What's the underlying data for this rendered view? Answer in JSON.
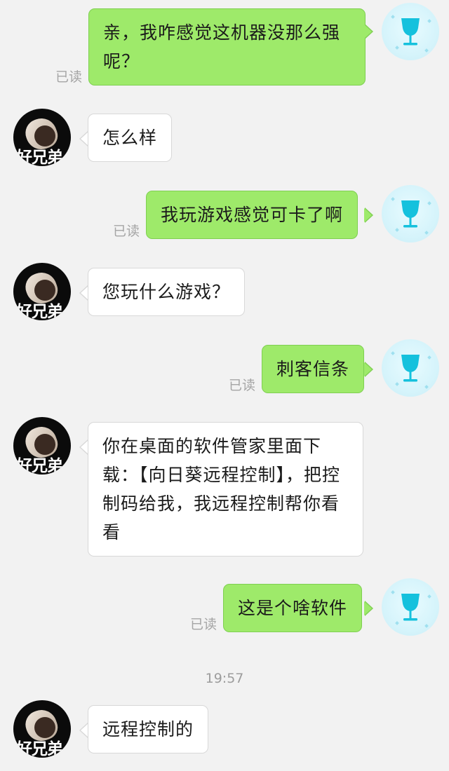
{
  "chat": {
    "read_label": "已读",
    "timestamp": "19:57",
    "other_avatar_text": "好兄弟",
    "messages": [
      {
        "from": "self",
        "text": "亲，我咋感觉这机器没那么强呢？",
        "read": true
      },
      {
        "from": "other",
        "text": "怎么样"
      },
      {
        "from": "self",
        "text": "我玩游戏感觉可卡了啊",
        "read": true
      },
      {
        "from": "other",
        "text": "您玩什么游戏？"
      },
      {
        "from": "self",
        "text": "刺客信条",
        "read": true
      },
      {
        "from": "other",
        "text": "你在桌面的软件管家里面下载：【向日葵远程控制】，把控制码给我，我远程控制帮你看看"
      },
      {
        "from": "self",
        "text": "这是个啥软件",
        "read": true
      },
      {
        "from": "other",
        "text": "远程控制的"
      }
    ]
  },
  "colors": {
    "outgoing_bubble": "#9eea6a",
    "incoming_bubble": "#ffffff",
    "self_avatar_icon": "#15c1dd",
    "background": "#f2f2f2"
  },
  "icons": {
    "self_avatar": "wine-glass-icon",
    "other_avatar": "clasped-hands-photo"
  }
}
